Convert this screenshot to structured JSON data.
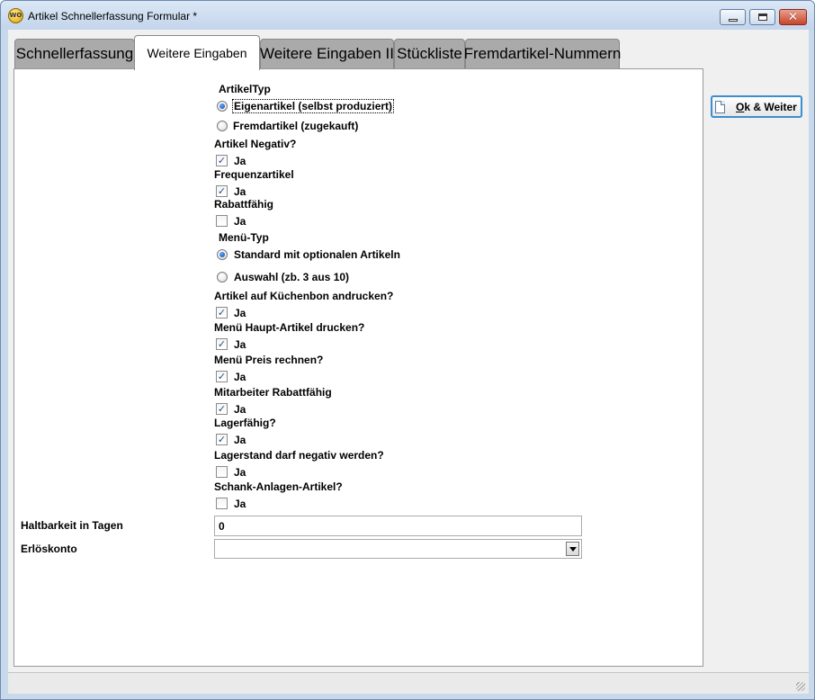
{
  "window": {
    "title": "Artikel Schnellerfassung Formular *",
    "app_icon_glyph": "WO",
    "controls": {
      "minimize": "minimize-icon",
      "maximize": "maximize-icon",
      "close": "close-icon"
    }
  },
  "tabs": [
    {
      "label": "Schnellerfassung",
      "active": false
    },
    {
      "label": "Weitere Eingaben",
      "active": true
    },
    {
      "label": "Weitere Eingaben II",
      "active": false
    },
    {
      "label": "Stückliste",
      "active": false
    },
    {
      "label": "Fremdartikel-Nummern",
      "active": false
    }
  ],
  "form": {
    "artikeltyp": {
      "label": "ArtikelTyp",
      "options": [
        {
          "label": "Eigenartikel (selbst produziert)",
          "selected": true
        },
        {
          "label": "Fremdartikel (zugekauft)",
          "selected": false
        }
      ]
    },
    "artikel_negativ": {
      "label": "Artikel Negativ?",
      "option": "Ja",
      "checked": true
    },
    "frequenzartikel": {
      "label": "Frequenzartikel",
      "option": "Ja",
      "checked": true
    },
    "rabattfaehig": {
      "label": "Rabattfähig",
      "option": "Ja",
      "checked": false
    },
    "menue_typ": {
      "label": "Menü-Typ",
      "options": [
        {
          "label": "Standard mit optionalen Artikeln",
          "selected": true
        },
        {
          "label": "Auswahl (zb. 3 aus 10)",
          "selected": false
        }
      ]
    },
    "kuechenbon": {
      "label": "Artikel auf Küchenbon andrucken?",
      "option": "Ja",
      "checked": true
    },
    "menue_haupt": {
      "label": "Menü Haupt-Artikel drucken?",
      "option": "Ja",
      "checked": true
    },
    "menue_preis": {
      "label": "Menü Preis rechnen?",
      "option": "Ja",
      "checked": true
    },
    "mitarbeiter_rabatt": {
      "label": "Mitarbeiter Rabattfähig",
      "option": "Ja",
      "checked": true
    },
    "lagerfaehig": {
      "label": "Lagerfähig?",
      "option": "Ja",
      "checked": true
    },
    "lagerstand_negativ": {
      "label": "Lagerstand darf negativ werden?",
      "option": "Ja",
      "checked": false
    },
    "schank_anlagen": {
      "label": "Schank-Anlagen-Artikel?",
      "option": "Ja",
      "checked": false
    },
    "haltbarkeit": {
      "label": "Haltbarkeit in Tagen",
      "value": "0"
    },
    "erloeskonto": {
      "label": "Erlöskonto",
      "value": ""
    }
  },
  "buttons": {
    "ok_weiter": {
      "label_prefix": "O",
      "label_rest": "k & Weiter",
      "icon": "document-icon"
    }
  },
  "check_glyph": "✓"
}
